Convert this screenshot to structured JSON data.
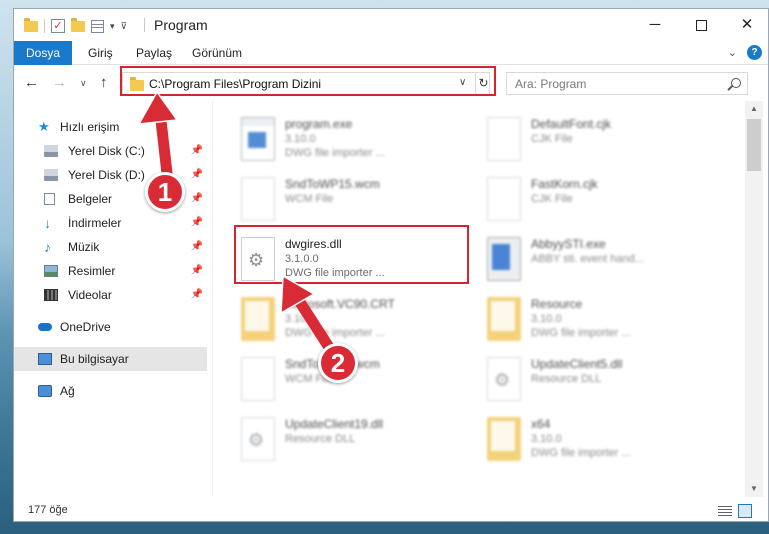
{
  "window": {
    "title": "Program"
  },
  "ribbon": {
    "tabs": [
      "Dosya",
      "Giriş",
      "Paylaş",
      "Görünüm"
    ]
  },
  "address": {
    "path": "C:\\Program Files\\Program Dizini"
  },
  "search": {
    "placeholder": "Ara: Program"
  },
  "nav": {
    "items": [
      {
        "label": "Hızlı erişim",
        "icon": "star-icon",
        "pinned": false
      },
      {
        "label": "Yerel Disk (C:)",
        "icon": "disk-icon",
        "pinned": true
      },
      {
        "label": "Yerel Disk (D:)",
        "icon": "disk-icon",
        "pinned": true
      },
      {
        "label": "Belgeler",
        "icon": "document-icon",
        "pinned": true
      },
      {
        "label": "İndirmeler",
        "icon": "download-icon",
        "pinned": true
      },
      {
        "label": "Müzik",
        "icon": "music-icon",
        "pinned": true
      },
      {
        "label": "Resimler",
        "icon": "pictures-icon",
        "pinned": true
      },
      {
        "label": "Videolar",
        "icon": "video-icon",
        "pinned": true
      },
      {
        "label": "OneDrive",
        "icon": "cloud-icon",
        "pinned": false
      },
      {
        "label": "Bu bilgisayar",
        "icon": "pc-icon",
        "pinned": false,
        "selected": true
      },
      {
        "label": "Ağ",
        "icon": "network-icon",
        "pinned": false
      }
    ]
  },
  "files": [
    {
      "name": "program.exe",
      "line1": "3.10.0",
      "line2": "DWG file importer ...",
      "icon": "exe-icon"
    },
    {
      "name": "DefaultFont.cjk",
      "line1": "CJK File",
      "line2": "",
      "icon": "file-icon"
    },
    {
      "name": "SndToWP15.wcm",
      "line1": "WCM File",
      "line2": "",
      "icon": "file-icon"
    },
    {
      "name": "FastKorn.cjk",
      "line1": "CJK File",
      "line2": "",
      "icon": "file-icon"
    },
    {
      "name": "dwgires.dll",
      "line1": "3.1.0.0",
      "line2": "DWG file importer ...",
      "icon": "dll-gear-icon"
    },
    {
      "name": "AbbyySTI.exe",
      "line1": "ABBY sti. event hand...",
      "line2": "",
      "icon": "app-icon"
    },
    {
      "name": "Microsoft.VC90.CRT",
      "line1": "3.10.0",
      "line2": "DWG file importer ...",
      "icon": "folder-icon"
    },
    {
      "name": "Resource",
      "line1": "3.10.0",
      "line2": "DWG file importer ...",
      "icon": "folder-icon"
    },
    {
      "name": "SndToWP16.wcm",
      "line1": "WCM File",
      "line2": "",
      "icon": "file-icon"
    },
    {
      "name": "UpdateClient5.dll",
      "line1": "Resource DLL",
      "line2": "",
      "icon": "dll-gear-icon"
    },
    {
      "name": "UpdateClient19.dll",
      "line1": "Resource DLL",
      "line2": "",
      "icon": "dll-gear-icon"
    },
    {
      "name": "x64",
      "line1": "3.10.0",
      "line2": "DWG file importer ...",
      "icon": "folder-icon"
    }
  ],
  "status": {
    "count": "177 öğe"
  },
  "annotations": {
    "step1": "1",
    "step2": "2",
    "color": "#d4242e"
  }
}
